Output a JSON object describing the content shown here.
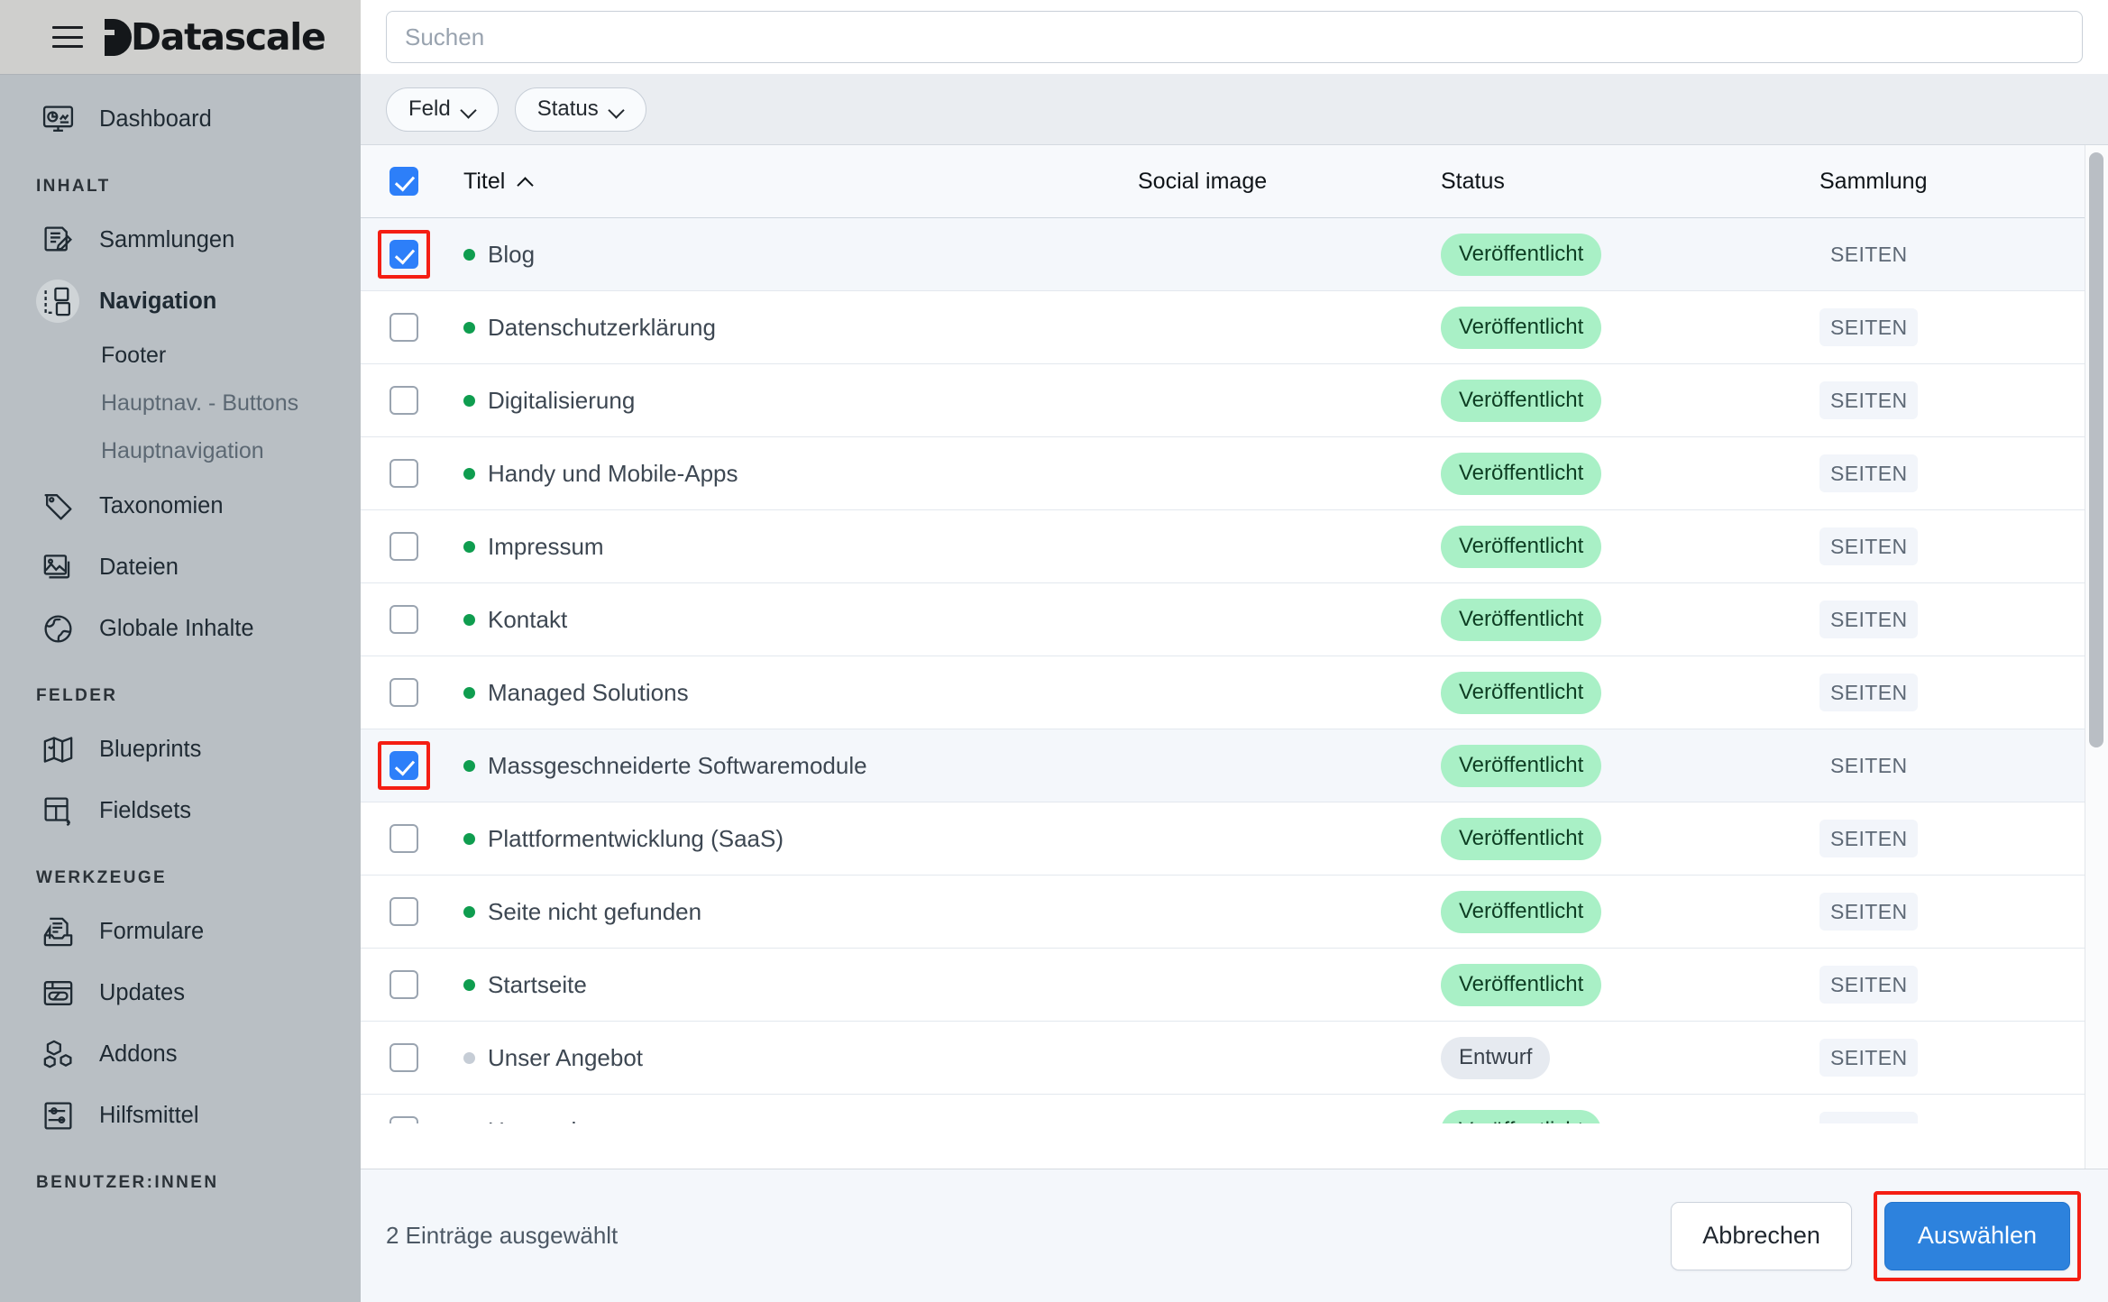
{
  "app": {
    "brand": "Datascale",
    "menu_icon": "hamburger-icon"
  },
  "sidebar": {
    "dashboard": {
      "label": "Dashboard",
      "icon": "dashboard-monitor-icon"
    },
    "sections": [
      {
        "heading": "INHALT",
        "items": [
          {
            "label": "Sammlungen",
            "icon": "collections-document-pencil-icon",
            "active": false
          },
          {
            "label": "Navigation",
            "icon": "navigation-pages-icon",
            "active": true
          }
        ],
        "subitems": [
          {
            "label": "Footer",
            "current": true
          },
          {
            "label": "Hauptnav. - Buttons",
            "current": false
          },
          {
            "label": "Hauptnavigation",
            "current": false
          }
        ],
        "items_after": [
          {
            "label": "Taxonomien",
            "icon": "tag-icon"
          },
          {
            "label": "Dateien",
            "icon": "image-stack-icon"
          },
          {
            "label": "Globale Inhalte",
            "icon": "globe-icon"
          }
        ]
      },
      {
        "heading": "FELDER",
        "items": [
          {
            "label": "Blueprints",
            "icon": "map-blueprint-icon"
          },
          {
            "label": "Fieldsets",
            "icon": "fieldset-layout-icon"
          }
        ]
      },
      {
        "heading": "WERKZEUGE",
        "items": [
          {
            "label": "Formulare",
            "icon": "form-inbox-icon"
          },
          {
            "label": "Updates",
            "icon": "updates-window-icon"
          },
          {
            "label": "Addons",
            "icon": "addons-boxes-icon"
          },
          {
            "label": "Hilfsmittel",
            "icon": "sliders-utilities-icon"
          }
        ]
      },
      {
        "heading": "BENUTZER:INNEN",
        "items": []
      }
    ]
  },
  "search": {
    "placeholder": "Suchen",
    "value": ""
  },
  "filters": [
    {
      "label": "Feld",
      "icon": "chevron-down-icon"
    },
    {
      "label": "Status",
      "icon": "chevron-down-icon"
    }
  ],
  "table": {
    "columns": {
      "title": "Titel",
      "social_image": "Social image",
      "status": "Status",
      "collection": "Sammlung"
    },
    "sort": {
      "column": "Titel",
      "direction": "asc",
      "icon": "chevron-up-icon"
    },
    "select_all_checked": true,
    "rows": [
      {
        "title": "Blog",
        "status": "Veröffentlicht",
        "state": "published",
        "collection": "SEITEN",
        "checked": true,
        "highlighted": true
      },
      {
        "title": "Datenschutzerklärung",
        "status": "Veröffentlicht",
        "state": "published",
        "collection": "SEITEN",
        "checked": false,
        "highlighted": false
      },
      {
        "title": "Digitalisierung",
        "status": "Veröffentlicht",
        "state": "published",
        "collection": "SEITEN",
        "checked": false,
        "highlighted": false
      },
      {
        "title": "Handy und Mobile-Apps",
        "status": "Veröffentlicht",
        "state": "published",
        "collection": "SEITEN",
        "checked": false,
        "highlighted": false
      },
      {
        "title": "Impressum",
        "status": "Veröffentlicht",
        "state": "published",
        "collection": "SEITEN",
        "checked": false,
        "highlighted": false
      },
      {
        "title": "Kontakt",
        "status": "Veröffentlicht",
        "state": "published",
        "collection": "SEITEN",
        "checked": false,
        "highlighted": false
      },
      {
        "title": "Managed Solutions",
        "status": "Veröffentlicht",
        "state": "published",
        "collection": "SEITEN",
        "checked": false,
        "highlighted": false
      },
      {
        "title": "Massgeschneiderte Softwaremodule",
        "status": "Veröffentlicht",
        "state": "published",
        "collection": "SEITEN",
        "checked": true,
        "highlighted": true
      },
      {
        "title": "Plattformentwicklung (SaaS)",
        "status": "Veröffentlicht",
        "state": "published",
        "collection": "SEITEN",
        "checked": false,
        "highlighted": false
      },
      {
        "title": "Seite nicht gefunden",
        "status": "Veröffentlicht",
        "state": "published",
        "collection": "SEITEN",
        "checked": false,
        "highlighted": false
      },
      {
        "title": "Startseite",
        "status": "Veröffentlicht",
        "state": "published",
        "collection": "SEITEN",
        "checked": false,
        "highlighted": false
      },
      {
        "title": "Unser Angebot",
        "status": "Entwurf",
        "state": "draft",
        "collection": "SEITEN",
        "checked": false,
        "highlighted": false
      },
      {
        "title": "Unternehmen",
        "status": "Veröffentlicht",
        "state": "published",
        "collection": "SEITEN",
        "checked": false,
        "highlighted": false
      }
    ]
  },
  "footer": {
    "selection_text": "2 Einträge ausgewählt",
    "cancel_label": "Abbrechen",
    "confirm_label": "Auswählen"
  },
  "colors": {
    "accent_blue": "#2d82dd",
    "checkbox_blue": "#2d7ff9",
    "published_badge_bg": "#a9f0c6",
    "draft_badge_bg": "#e6eaf0",
    "status_dot_green": "#0f9d4f",
    "highlight_red": "#f41e13",
    "sidebar_bg": "#b9bfc4"
  }
}
